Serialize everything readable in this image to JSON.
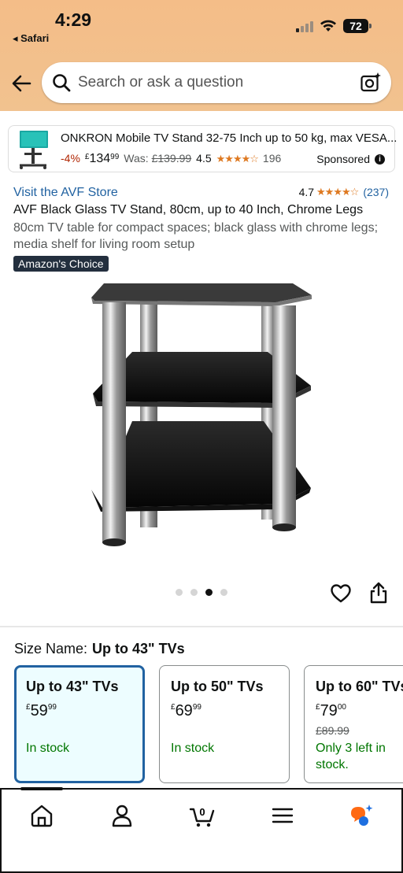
{
  "status_bar": {
    "time": "4:29",
    "back_label": "◂ Safari",
    "battery": "72"
  },
  "search": {
    "placeholder": "Search or ask a question"
  },
  "ad": {
    "title": "ONKRON Mobile TV Stand 32-75 Inch up to 50 kg, max VESA...",
    "discount": "-4%",
    "price_symbol": "£",
    "price_whole": "134",
    "price_fraction": "99",
    "was_label": "Was:",
    "was_price": "£139.99",
    "rating": "4.5",
    "stars": "★★★★☆",
    "review_count": "196",
    "sponsored_label": "Sponsored",
    "info_glyph": "i"
  },
  "product": {
    "store_link": "Visit the AVF Store",
    "rating": "4.7",
    "stars": "★★★★☆",
    "review_count": "(237)",
    "title": "AVF Black Glass TV Stand, 80cm, up to 40 Inch, Chrome Legs",
    "description": "80cm TV table for compact spaces; black glass with chrome legs; media shelf for living room setup",
    "badge": "Amazon's Choice",
    "image_count": 4,
    "active_image": 3
  },
  "size_selector": {
    "label": "Size Name:",
    "selected_value": "Up to 43\" TVs",
    "options": [
      {
        "name": "Up to 43\" TVs",
        "symbol": "£",
        "whole": "59",
        "fraction": "99",
        "old_price": "",
        "stock": "In stock"
      },
      {
        "name": "Up to 50\" TVs",
        "symbol": "£",
        "whole": "69",
        "fraction": "99",
        "old_price": "",
        "stock": "In stock"
      },
      {
        "name": "Up to 60\" TVs",
        "symbol": "£",
        "whole": "79",
        "fraction": "00",
        "old_price": "£89.99",
        "stock": "Only 3 left in stock."
      }
    ]
  },
  "bottom_nav": {
    "cart_count": "0"
  },
  "colors": {
    "header": "#f3bf8b",
    "link": "#2162a1",
    "in_stock": "#007600",
    "star": "#de7921",
    "selected_border": "#2162a1"
  }
}
